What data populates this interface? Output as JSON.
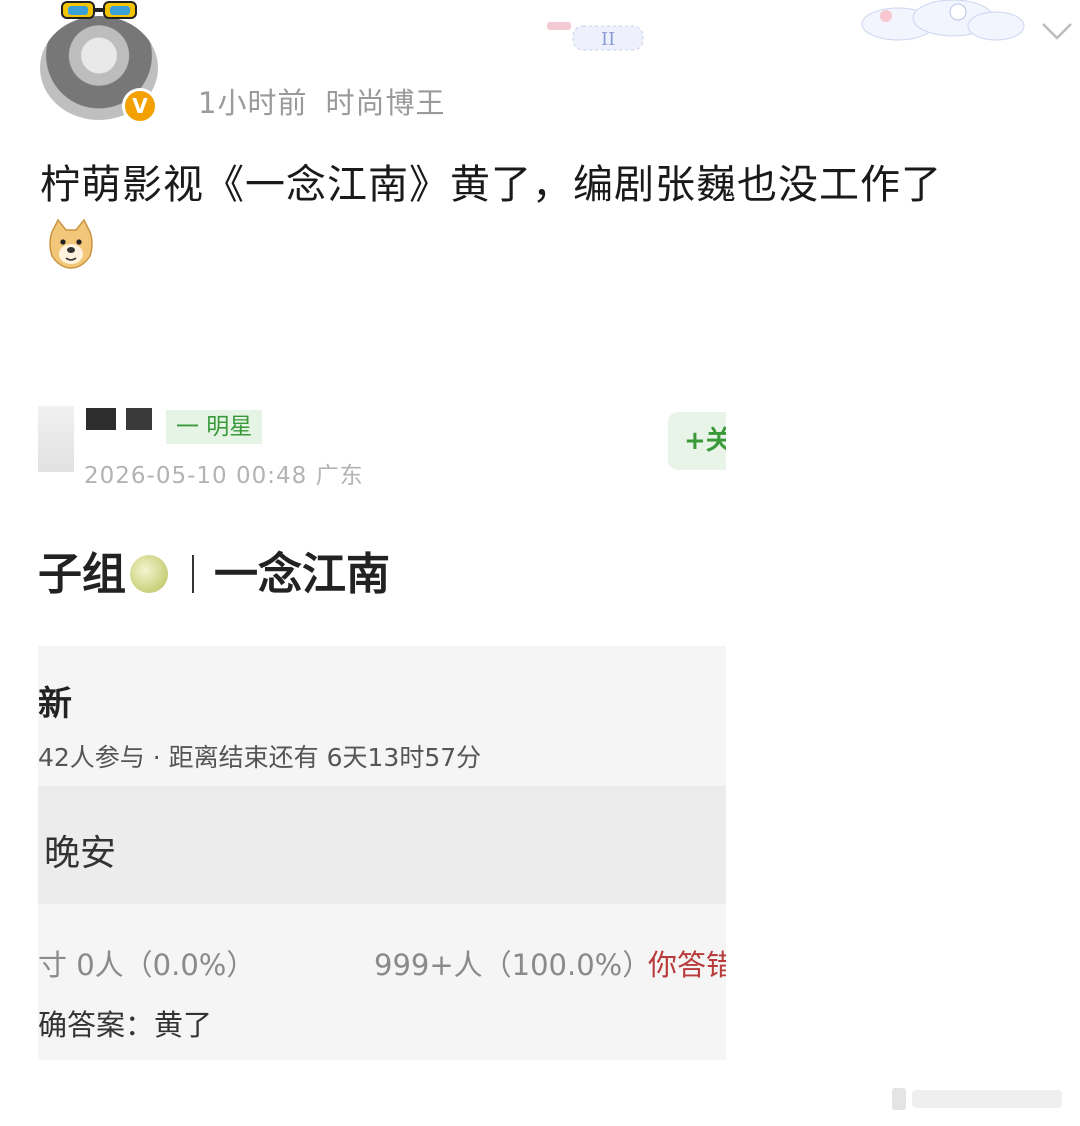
{
  "header": {
    "time": "1小时前",
    "source": "时尚博王",
    "verified_badge": "V"
  },
  "post": {
    "text": "柠萌影视《一念江南》黄了，编剧张巍也没工作了",
    "emoji": "doge-emoji"
  },
  "embedded": {
    "tag_label": "一 明星",
    "date_location": "2026-05-10 00:48  广东",
    "follow_label": "+关",
    "title": "子组",
    "title_suffix": "一念江南",
    "poll": {
      "title": "新",
      "stats": "42人参与 · 距离结束还有 6天13时57分",
      "option": "晚安",
      "result_left": "寸  0人（0.0%）",
      "result_right": "999+人（100.0%）",
      "result_tag": "你答错",
      "answer": "确答案：黄了"
    }
  },
  "colors": {
    "badge": "#f2a100",
    "green_tag": "#3a9a3a",
    "wrong_red": "#b83a3a"
  }
}
